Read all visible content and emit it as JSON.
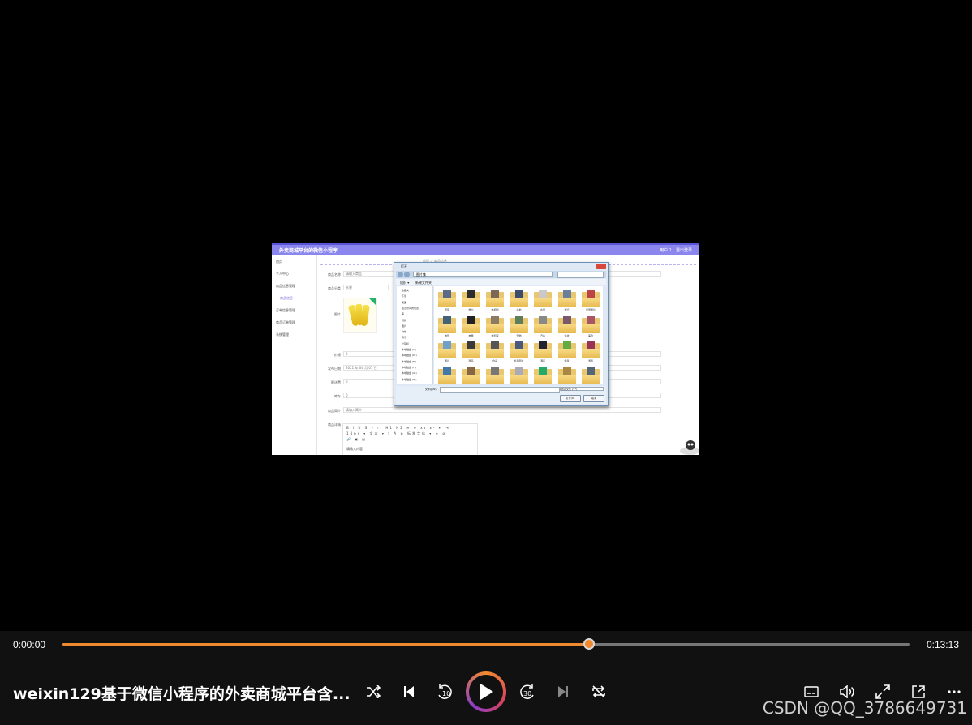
{
  "video": {
    "frame": {
      "app_title": "外卖商城平台的微信小程序",
      "user_label": "用户 1",
      "logout_label": "退出登录",
      "breadcrumb": "首页 > 商品信息",
      "sidebar": [
        "首页",
        "个人中心",
        "商品信息管理",
        "商品信息",
        "订单信息管理",
        "商品订单管理",
        "系统管理"
      ],
      "form_labels": [
        "商品名称",
        "商品分类",
        "图片",
        "价格",
        "发布日期",
        "配送费",
        "库存",
        "商品简介",
        "商品详情"
      ],
      "form_values": [
        "请输入商品",
        "水果",
        "",
        "0",
        "2021 年 04 月 01 日",
        "0",
        "0",
        "请输入简介",
        ""
      ],
      "editor_hint": "请输入内容",
      "file_dialog": {
        "title": "打开",
        "address": "图片集",
        "toolbar": [
          "组织 ▾",
          "新建文件夹"
        ],
        "tree": [
          "收藏夹",
          "下载",
          "桌面",
          "最近访问的位置",
          "库",
          "视频",
          "图片",
          "文档",
          "音乐",
          "计算机",
          "本地磁盘 (C:)",
          "本地磁盘 (D:)",
          "本地磁盘 (E:)",
          "本地磁盘 (F:)",
          "本地磁盘 (G:)",
          "本地磁盘 (H:)"
        ],
        "folders": [
          "蔬菜",
          "婚纱",
          "电视剧",
          "房地",
          "水果",
          "旅行",
          "加盟图片",
          "电影",
          "电器",
          "电影院",
          "宠物",
          "汽车",
          "化妆",
          "美食",
          "图片",
          "甜品",
          "食品",
          "外卖图片",
          "酒店",
          "健身",
          "游戏",
          "公寓",
          "家具",
          "装修",
          "书籍",
          "篮球",
          "足球",
          "户外"
        ],
        "filename_label": "文件名(N):",
        "filetype": "所有文件 (*.*)",
        "open_button": "打开(O)",
        "cancel_button": "取消"
      }
    }
  },
  "player": {
    "current_time": "0:00:00",
    "total_time": "0:13:13",
    "progress_fraction": 0.6215,
    "title": "weixin129基于微信小程序的外卖商城平台含...",
    "watermark": "CSDN @QQ_3786649731",
    "accent_color": "#f08a30",
    "icons": {
      "shuffle": "shuffle-icon",
      "previous": "skip-previous-icon",
      "rewind": "rewind-10-icon",
      "play": "play-icon",
      "forward": "forward-30-icon",
      "next": "skip-next-icon",
      "repeat": "repeat-icon",
      "captions": "captions-icon",
      "volume": "volume-icon",
      "fullscreen": "fullscreen-icon",
      "mini": "mini-player-icon",
      "more": "more-icon"
    }
  }
}
